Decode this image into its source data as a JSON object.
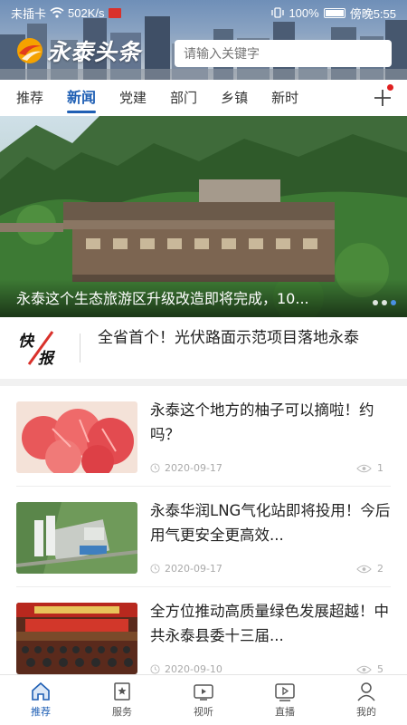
{
  "status_bar": {
    "carrier": "未插卡",
    "speed": "502K/s",
    "battery": "100%",
    "time": "傍晚5:55"
  },
  "header": {
    "app_title": "永泰头条",
    "search_placeholder": "请输入关键字"
  },
  "tabs": [
    {
      "label": "推荐",
      "active": false
    },
    {
      "label": "新闻",
      "active": true
    },
    {
      "label": "党建",
      "active": false
    },
    {
      "label": "部门",
      "active": false
    },
    {
      "label": "乡镇",
      "active": false
    },
    {
      "label": "新时",
      "active": false
    }
  ],
  "hero": {
    "title": "永泰这个生态旅游区升级改造即将完成，10..."
  },
  "flash": {
    "logo": "快报",
    "text": "全省首个！光伏路面示范项目落地永泰"
  },
  "news": [
    {
      "title": "永泰这个地方的柚子可以摘啦！约吗？",
      "date": "2020-09-17",
      "views": "1"
    },
    {
      "title": "永泰华润LNG气化站即将投用！今后用气更安全更高效...",
      "date": "2020-09-17",
      "views": "2"
    },
    {
      "title": "全方位推动高质量绿色发展超越！中共永泰县委十三届...",
      "date": "2020-09-10",
      "views": "5"
    }
  ],
  "bottom_nav": [
    {
      "label": "推荐",
      "icon": "home-icon",
      "active": true
    },
    {
      "label": "服务",
      "icon": "star-icon",
      "active": false
    },
    {
      "label": "视听",
      "icon": "tv-icon",
      "active": false
    },
    {
      "label": "直播",
      "icon": "play-icon",
      "active": false
    },
    {
      "label": "我的",
      "icon": "user-icon",
      "active": false
    }
  ],
  "colors": {
    "accent": "#1f5fb4",
    "notification_dot": "#e02020"
  }
}
